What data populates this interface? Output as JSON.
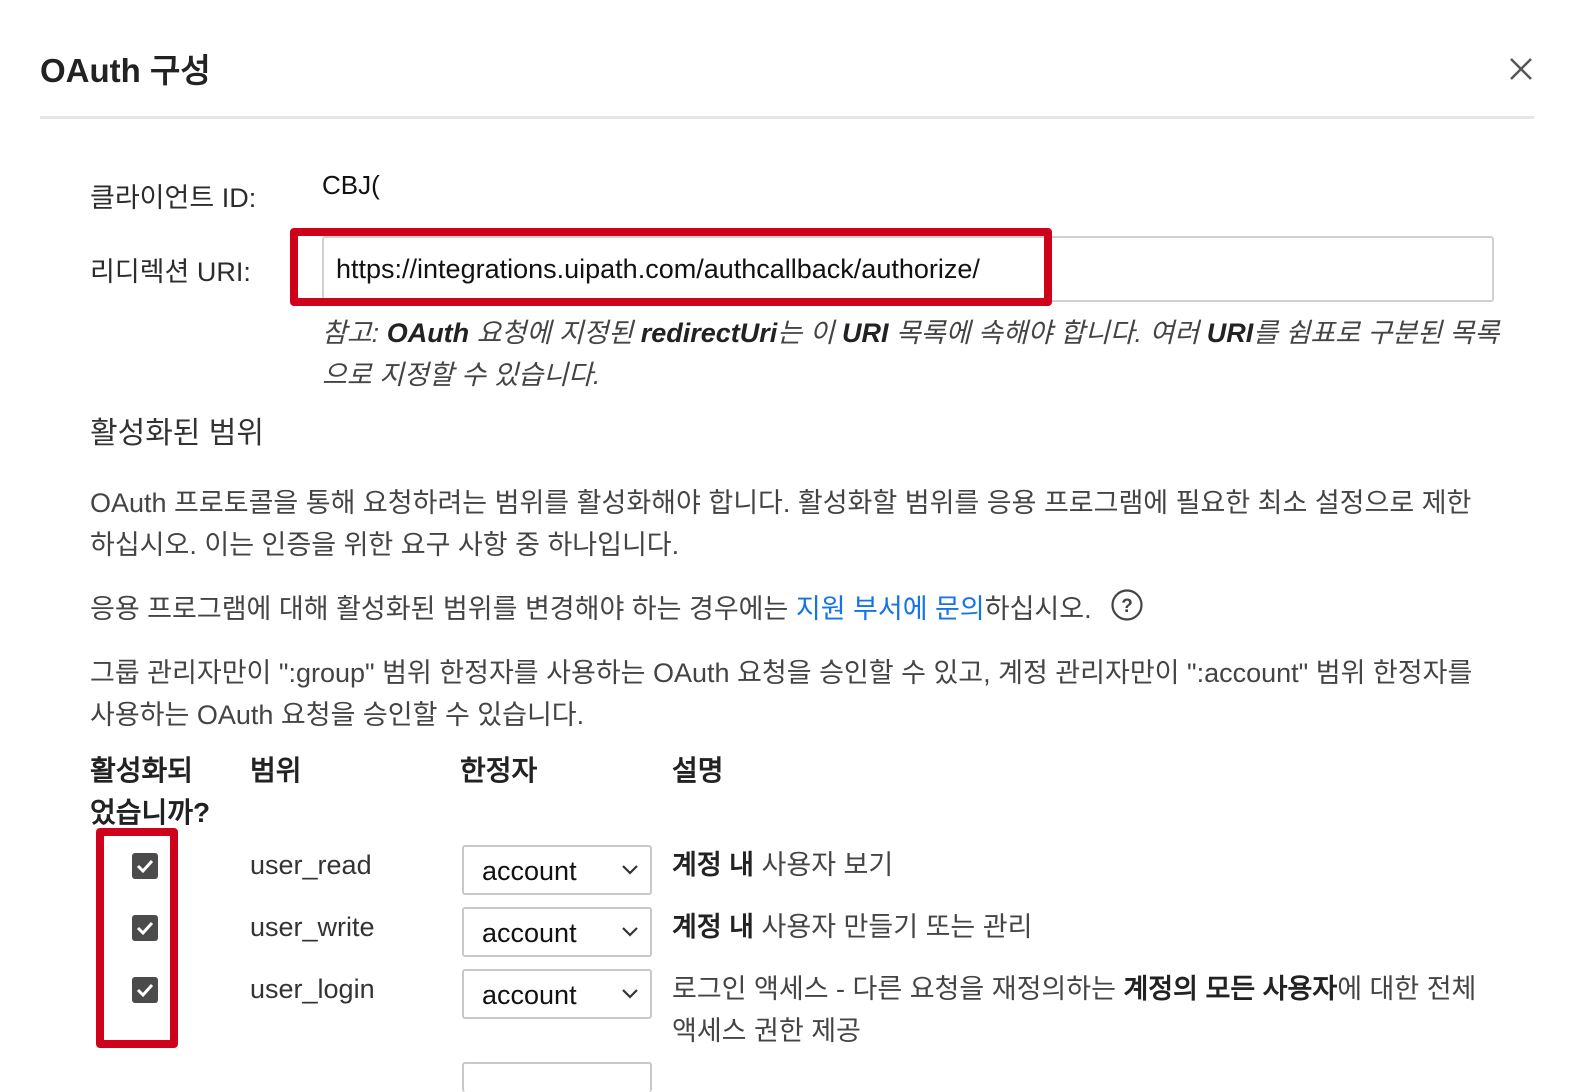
{
  "dialog": {
    "title": "OAuth 구성",
    "close_icon": "close-icon"
  },
  "client_id": {
    "label": "클라이언트 ID:",
    "value": "CBJ("
  },
  "redirect_uri": {
    "label": "리디렉션 URI:",
    "value": "https://integrations.uipath.com/authcallback/authorize/",
    "note_parts": [
      "참고: ",
      "OAuth",
      " 요청에 지정된 ",
      "redirectUri",
      "는 이 ",
      "URI",
      " 목록에 속해야 합니다. 여러 ",
      "URI",
      "를 쉼표로 구분된 목록으로 지정할 수 있습니다."
    ]
  },
  "scopes_section": {
    "heading": "활성화된 범위",
    "para1": "OAuth 프로토콜을 통해 요청하려는 범위를 활성화해야 합니다. 활성화할 범위를 응용 프로그램에 필요한 최소 설정으로 제한하십시오. 이는 인증을 위한 요구 사항 중 하나입니다.",
    "para2_before": "응용 프로그램에 대해 활성화된 범위를 변경해야 하는 경우에는 ",
    "para2_link": "지원 부서에 문의",
    "para2_after": "하십시오.",
    "help_icon": "help-circle-icon",
    "para3": "그룹 관리자만이 \":group\" 범위 한정자를 사용하는 OAuth 요청을 승인할 수 있고, 계정 관리자만이 \":account\" 범위 한정자를 사용하는 OAuth 요청을 승인할 수 있습니다."
  },
  "table": {
    "headers": {
      "enabled_line1": "활성화되",
      "enabled_line2": "었습니까?",
      "scope": "범위",
      "qualifier": "한정자",
      "description": "설명"
    },
    "rows": [
      {
        "checked": true,
        "scope": "user_read",
        "qualifier": "account",
        "desc_bold": "계정 내",
        "desc_rest": " 사용자 보기"
      },
      {
        "checked": true,
        "scope": "user_write",
        "qualifier": "account",
        "desc_bold": "계정 내",
        "desc_rest": " 사용자 만들기 또는 관리"
      },
      {
        "checked": true,
        "scope": "user_login",
        "qualifier": "account",
        "desc_pre": "로그인 액세스 - 다른 요청을 재정의하는 ",
        "desc_bold": "계정의 모든 사용자",
        "desc_rest": "에 대한 전체 액세스 권한 제공"
      }
    ]
  },
  "colors": {
    "highlight": "#d0021b",
    "link": "#1473e6",
    "checkbox": "#4b4b4b"
  }
}
